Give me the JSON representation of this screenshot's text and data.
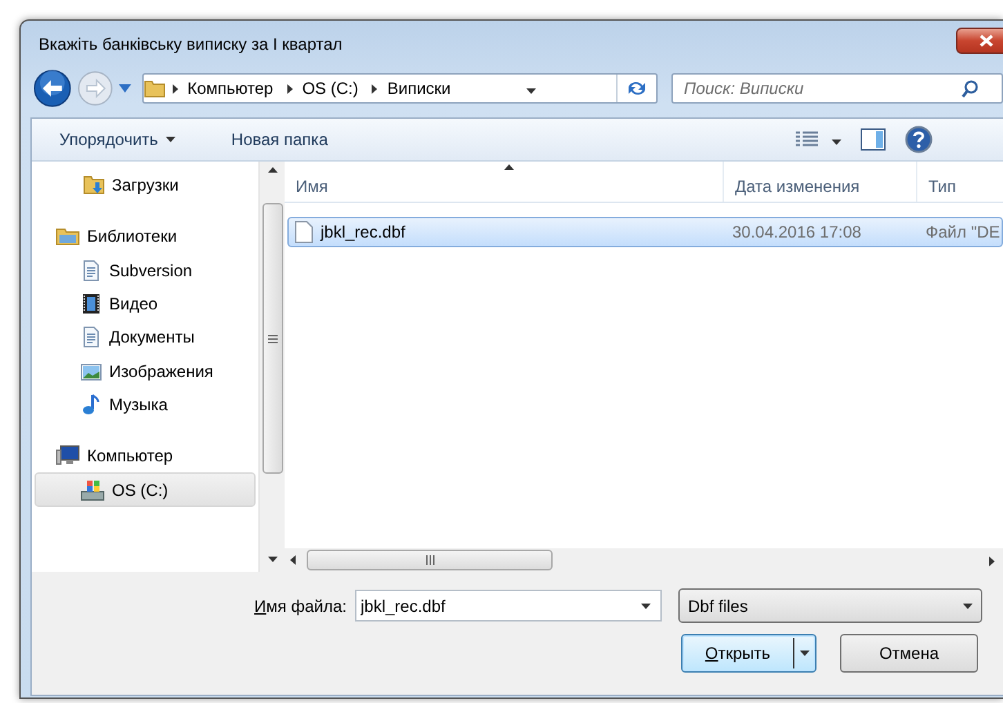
{
  "window": {
    "title": "Вкажіть банківську виписку за I квартал"
  },
  "address": {
    "crumbs": [
      "Компьютер",
      "OS (C:)",
      "Виписки"
    ]
  },
  "search": {
    "placeholder": "Поиск: Виписки"
  },
  "toolbar": {
    "buttons": [
      "Упорядочить",
      "Новая папка"
    ]
  },
  "sidebar": {
    "items": [
      {
        "label": "Загрузки",
        "kind": "downloads",
        "selected": false
      },
      {
        "label": "Библиотеки",
        "kind": "libraries",
        "selected": false,
        "children": [
          {
            "label": "Subversion",
            "kind": "document",
            "selected": false
          },
          {
            "label": "Видео",
            "kind": "video",
            "selected": false
          },
          {
            "label": "Документы",
            "kind": "document",
            "selected": false
          },
          {
            "label": "Изображения",
            "kind": "images",
            "selected": false
          },
          {
            "label": "Музыка",
            "kind": "music",
            "selected": false
          }
        ]
      },
      {
        "label": "Компьютер",
        "kind": "computer",
        "selected": false,
        "children": [
          {
            "label": "OS (C:)",
            "kind": "drive",
            "selected": true
          }
        ]
      }
    ]
  },
  "table": {
    "columns": [
      {
        "label": "Имя",
        "sorted": true
      },
      {
        "label": "Дата изменения",
        "sorted": false
      },
      {
        "label": "Тип",
        "sorted": false
      }
    ],
    "rows": [
      {
        "name": "jbkl_rec.dbf",
        "date": "30.04.2016 17:08",
        "type": "Файл \"DE",
        "selected": true
      }
    ]
  },
  "footer": {
    "filename_label": "Имя файла:",
    "filename": "jbkl_rec.dbf",
    "filter": "Dbf files",
    "open": "Открыть",
    "cancel": "Отмена"
  }
}
